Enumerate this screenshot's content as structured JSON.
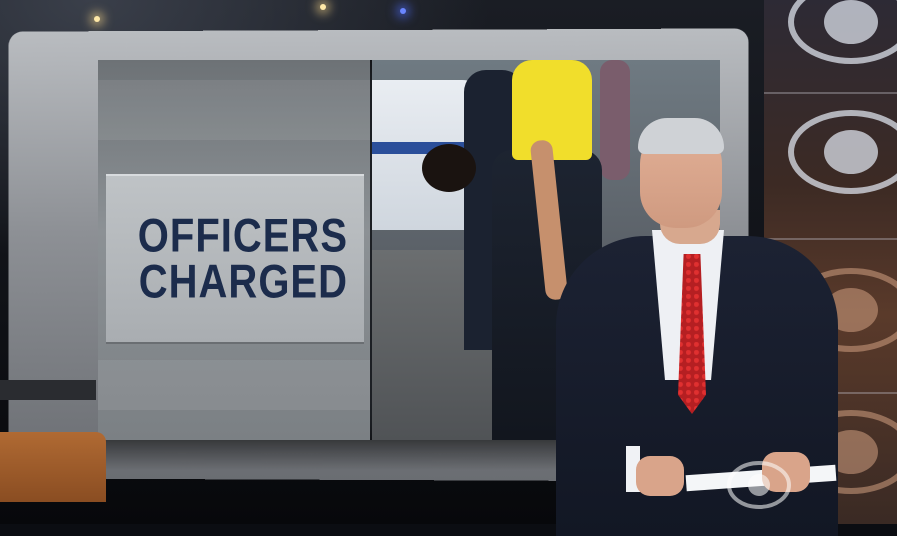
{
  "graphic": {
    "headline_lines": [
      "OFFICERS",
      "CHARGED"
    ]
  },
  "network": {
    "logo": "cbs-eye-icon"
  },
  "colors": {
    "headline_text": "#1c2c4c",
    "tie": "#b51f22",
    "suit": "#1c2233"
  }
}
